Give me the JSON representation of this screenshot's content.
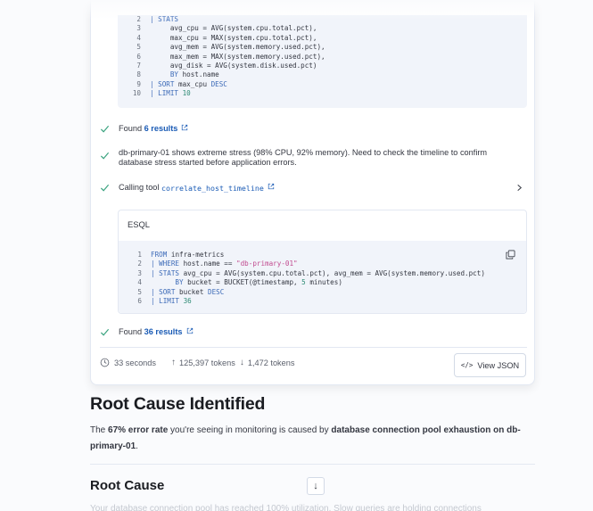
{
  "query1": {
    "lines": [
      {
        "n": "2",
        "parts": [
          {
            "t": "| STATS",
            "c": "kw"
          }
        ]
      },
      {
        "n": "3",
        "parts": [
          {
            "t": "     avg_cpu = AVG(system.cpu.total.pct),",
            "c": ""
          }
        ]
      },
      {
        "n": "4",
        "parts": [
          {
            "t": "     max_cpu = MAX(system.cpu.total.pct),",
            "c": ""
          }
        ]
      },
      {
        "n": "5",
        "parts": [
          {
            "t": "     avg_mem = AVG(system.memory.used.pct),",
            "c": ""
          }
        ]
      },
      {
        "n": "6",
        "parts": [
          {
            "t": "     max_mem = MAX(system.memory.used.pct),",
            "c": ""
          }
        ]
      },
      {
        "n": "7",
        "parts": [
          {
            "t": "     avg_disk = AVG(system.disk.used.pct)",
            "c": ""
          }
        ]
      },
      {
        "n": "8",
        "parts": [
          {
            "t": "     BY",
            "c": "kw"
          },
          {
            "t": " host.name",
            "c": ""
          }
        ]
      },
      {
        "n": "9",
        "parts": [
          {
            "t": "| SORT",
            "c": "kw"
          },
          {
            "t": " max_cpu ",
            "c": ""
          },
          {
            "t": "DESC",
            "c": "kw"
          }
        ]
      },
      {
        "n": "10",
        "parts": [
          {
            "t": "| LIMIT",
            "c": "kw"
          },
          {
            "t": " 10",
            "c": "num"
          }
        ]
      }
    ]
  },
  "steps": {
    "found1_prefix": "Found ",
    "found1_link": "6 results",
    "analysis_text": "db-primary-01 shows extreme stress (98% CPU, 92% memory). Need to check the timeline to confirm database stress started before application errors.",
    "calling_prefix": "Calling tool ",
    "calling_tool": "correlate_host_timeline",
    "found2_prefix": "Found ",
    "found2_link": "36 results"
  },
  "esql": {
    "title": "ESQL",
    "lines": [
      {
        "n": "1",
        "parts": [
          {
            "t": "FROM",
            "c": "kw"
          },
          {
            "t": " infra-metrics",
            "c": ""
          }
        ]
      },
      {
        "n": "2",
        "parts": [
          {
            "t": "| WHERE",
            "c": "kw"
          },
          {
            "t": " host.name == ",
            "c": ""
          },
          {
            "t": "\"db-primary-01\"",
            "c": "str"
          }
        ]
      },
      {
        "n": "3",
        "parts": [
          {
            "t": "| STATS",
            "c": "kw"
          },
          {
            "t": " avg_cpu = AVG(system.cpu.total.pct), avg_mem = AVG(system.memory.used.pct)",
            "c": ""
          }
        ]
      },
      {
        "n": "4",
        "parts": [
          {
            "t": "      BY",
            "c": "kw"
          },
          {
            "t": " bucket = BUCKET(@timestamp, ",
            "c": ""
          },
          {
            "t": "5",
            "c": "num"
          },
          {
            "t": " minutes)",
            "c": ""
          }
        ]
      },
      {
        "n": "5",
        "parts": [
          {
            "t": "| SORT",
            "c": "kw"
          },
          {
            "t": " bucket ",
            "c": ""
          },
          {
            "t": "DESC",
            "c": "kw"
          }
        ]
      },
      {
        "n": "6",
        "parts": [
          {
            "t": "| LIMIT",
            "c": "kw"
          },
          {
            "t": " 36",
            "c": "num"
          }
        ]
      }
    ]
  },
  "footer": {
    "duration": "33 seconds",
    "tokens_in": "125,397 tokens",
    "tokens_out": "1,472 tokens",
    "view_json": "View JSON"
  },
  "report": {
    "title": "Root Cause Identified",
    "p_1": "The ",
    "p_2": "67% error rate",
    "p_3": " you're seeing in monitoring is caused by ",
    "p_4": "database connection pool exhaustion on db-primary-01",
    "p_5": ".",
    "section_title": "Root Cause",
    "download_icon": "↓",
    "faded_text": "Your database connection pool has reached 100% utilization. Slow queries are holding connections"
  },
  "colors": {
    "check": "#3aa37f",
    "link": "#1a5bb5",
    "keyword": "#3d6bb8",
    "string": "#c14a8f",
    "number": "#2d8a74"
  }
}
